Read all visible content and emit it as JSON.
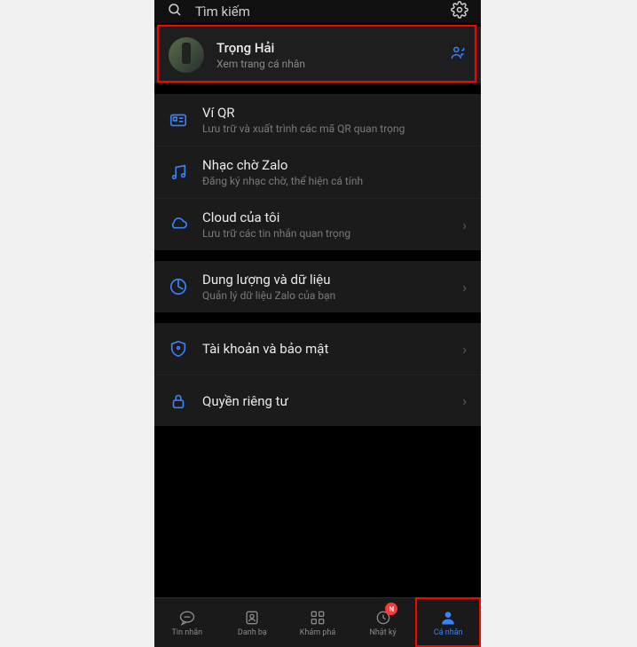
{
  "header": {
    "search_placeholder": "Tìm kiếm"
  },
  "profile": {
    "name": "Trọng Hải",
    "subtitle": "Xem trang cá nhân"
  },
  "sections": {
    "qr": {
      "title": "Ví QR",
      "sub": "Lưu trữ và xuất trình các mã QR quan trọng"
    },
    "music": {
      "title": "Nhạc chờ Zalo",
      "sub": "Đăng ký nhạc chờ, thể hiện cá tính"
    },
    "cloud": {
      "title": "Cloud của tôi",
      "sub": "Lưu trữ các tin nhắn quan trọng"
    },
    "storage": {
      "title": "Dung lượng và dữ liệu",
      "sub": "Quản lý dữ liệu Zalo của bạn"
    },
    "security": {
      "title": "Tài khoản và bảo mật",
      "sub": ""
    },
    "privacy": {
      "title": "Quyền riêng tư",
      "sub": ""
    }
  },
  "nav": {
    "messages": "Tin nhắn",
    "contacts": "Danh bạ",
    "discover": "Khám phá",
    "diary": "Nhật ký",
    "diary_badge": "N",
    "profile": "Cá nhân"
  }
}
